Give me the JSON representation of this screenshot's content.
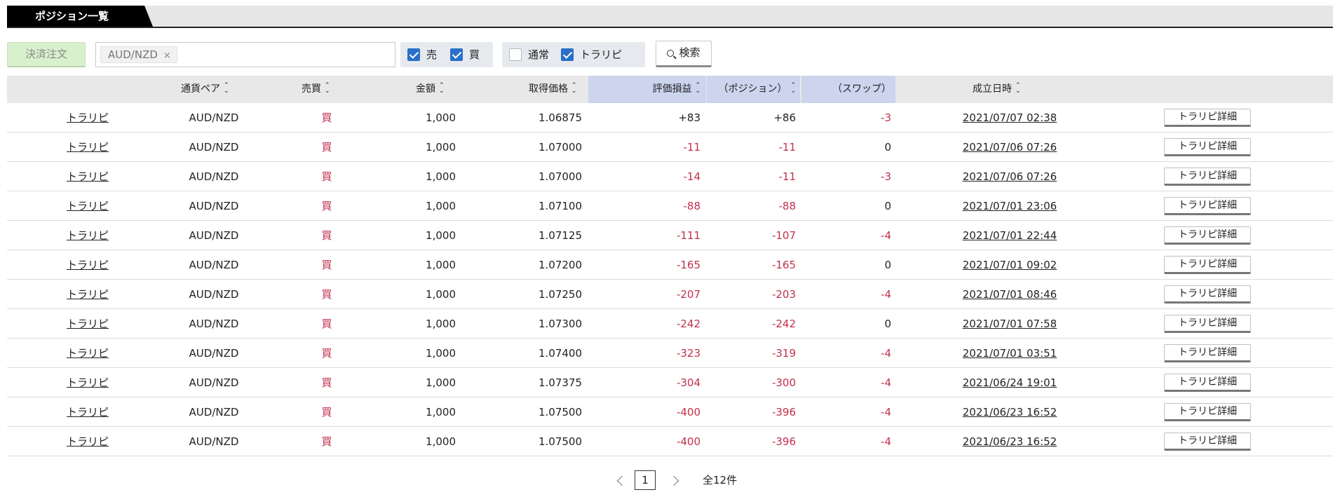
{
  "panel": {
    "title": "ポジション一覧"
  },
  "toolbar": {
    "settle_label": "決済注文",
    "filter_chip": "AUD/NZD",
    "chip_remove": "×",
    "sell_label": "売",
    "buy_label": "買",
    "normal_label": "通常",
    "trarepi_label": "トラリピ",
    "search_label": "検索",
    "checkboxes": {
      "sell": true,
      "buy": true,
      "normal": false,
      "trarepi": true
    }
  },
  "table": {
    "headers": {
      "pair": "通貨ペア",
      "side": "売買",
      "amount": "金額",
      "price": "取得価格",
      "pnl": "評価損益",
      "position": "（ポジション）",
      "swap": "（スワップ）",
      "date": "成立日時"
    },
    "sort_up": "^",
    "sort_down": "v",
    "rows": [
      {
        "type": "トラリピ",
        "pair": "AUD/NZD",
        "side": "買",
        "amount": "1,000",
        "price": "1.06875",
        "pnl": "+83",
        "position": "+86",
        "swap": "-3",
        "date": "2021/07/07 02:38",
        "action": "トラリピ詳細"
      },
      {
        "type": "トラリピ",
        "pair": "AUD/NZD",
        "side": "買",
        "amount": "1,000",
        "price": "1.07000",
        "pnl": "-11",
        "position": "-11",
        "swap": "0",
        "date": "2021/07/06 07:26",
        "action": "トラリピ詳細"
      },
      {
        "type": "トラリピ",
        "pair": "AUD/NZD",
        "side": "買",
        "amount": "1,000",
        "price": "1.07000",
        "pnl": "-14",
        "position": "-11",
        "swap": "-3",
        "date": "2021/07/06 07:26",
        "action": "トラリピ詳細"
      },
      {
        "type": "トラリピ",
        "pair": "AUD/NZD",
        "side": "買",
        "amount": "1,000",
        "price": "1.07100",
        "pnl": "-88",
        "position": "-88",
        "swap": "0",
        "date": "2021/07/01 23:06",
        "action": "トラリピ詳細"
      },
      {
        "type": "トラリピ",
        "pair": "AUD/NZD",
        "side": "買",
        "amount": "1,000",
        "price": "1.07125",
        "pnl": "-111",
        "position": "-107",
        "swap": "-4",
        "date": "2021/07/01 22:44",
        "action": "トラリピ詳細"
      },
      {
        "type": "トラリピ",
        "pair": "AUD/NZD",
        "side": "買",
        "amount": "1,000",
        "price": "1.07200",
        "pnl": "-165",
        "position": "-165",
        "swap": "0",
        "date": "2021/07/01 09:02",
        "action": "トラリピ詳細"
      },
      {
        "type": "トラリピ",
        "pair": "AUD/NZD",
        "side": "買",
        "amount": "1,000",
        "price": "1.07250",
        "pnl": "-207",
        "position": "-203",
        "swap": "-4",
        "date": "2021/07/01 08:46",
        "action": "トラリピ詳細"
      },
      {
        "type": "トラリピ",
        "pair": "AUD/NZD",
        "side": "買",
        "amount": "1,000",
        "price": "1.07300",
        "pnl": "-242",
        "position": "-242",
        "swap": "0",
        "date": "2021/07/01 07:58",
        "action": "トラリピ詳細"
      },
      {
        "type": "トラリピ",
        "pair": "AUD/NZD",
        "side": "買",
        "amount": "1,000",
        "price": "1.07400",
        "pnl": "-323",
        "position": "-319",
        "swap": "-4",
        "date": "2021/07/01 03:51",
        "action": "トラリピ詳細"
      },
      {
        "type": "トラリピ",
        "pair": "AUD/NZD",
        "side": "買",
        "amount": "1,000",
        "price": "1.07375",
        "pnl": "-304",
        "position": "-300",
        "swap": "-4",
        "date": "2021/06/24 19:01",
        "action": "トラリピ詳細"
      },
      {
        "type": "トラリピ",
        "pair": "AUD/NZD",
        "side": "買",
        "amount": "1,000",
        "price": "1.07500",
        "pnl": "-400",
        "position": "-396",
        "swap": "-4",
        "date": "2021/06/23 16:52",
        "action": "トラリピ詳細"
      },
      {
        "type": "トラリピ",
        "pair": "AUD/NZD",
        "side": "買",
        "amount": "1,000",
        "price": "1.07500",
        "pnl": "-400",
        "position": "-396",
        "swap": "-4",
        "date": "2021/06/23 16:52",
        "action": "トラリピ詳細"
      }
    ]
  },
  "pagination": {
    "current": "1",
    "total": "全12件"
  },
  "colors": {
    "negative": "#c0304c",
    "highlight_header": "#ccd4ee",
    "settle_button": "#d9f0cd",
    "checkbox_on": "#2a6fc9"
  }
}
